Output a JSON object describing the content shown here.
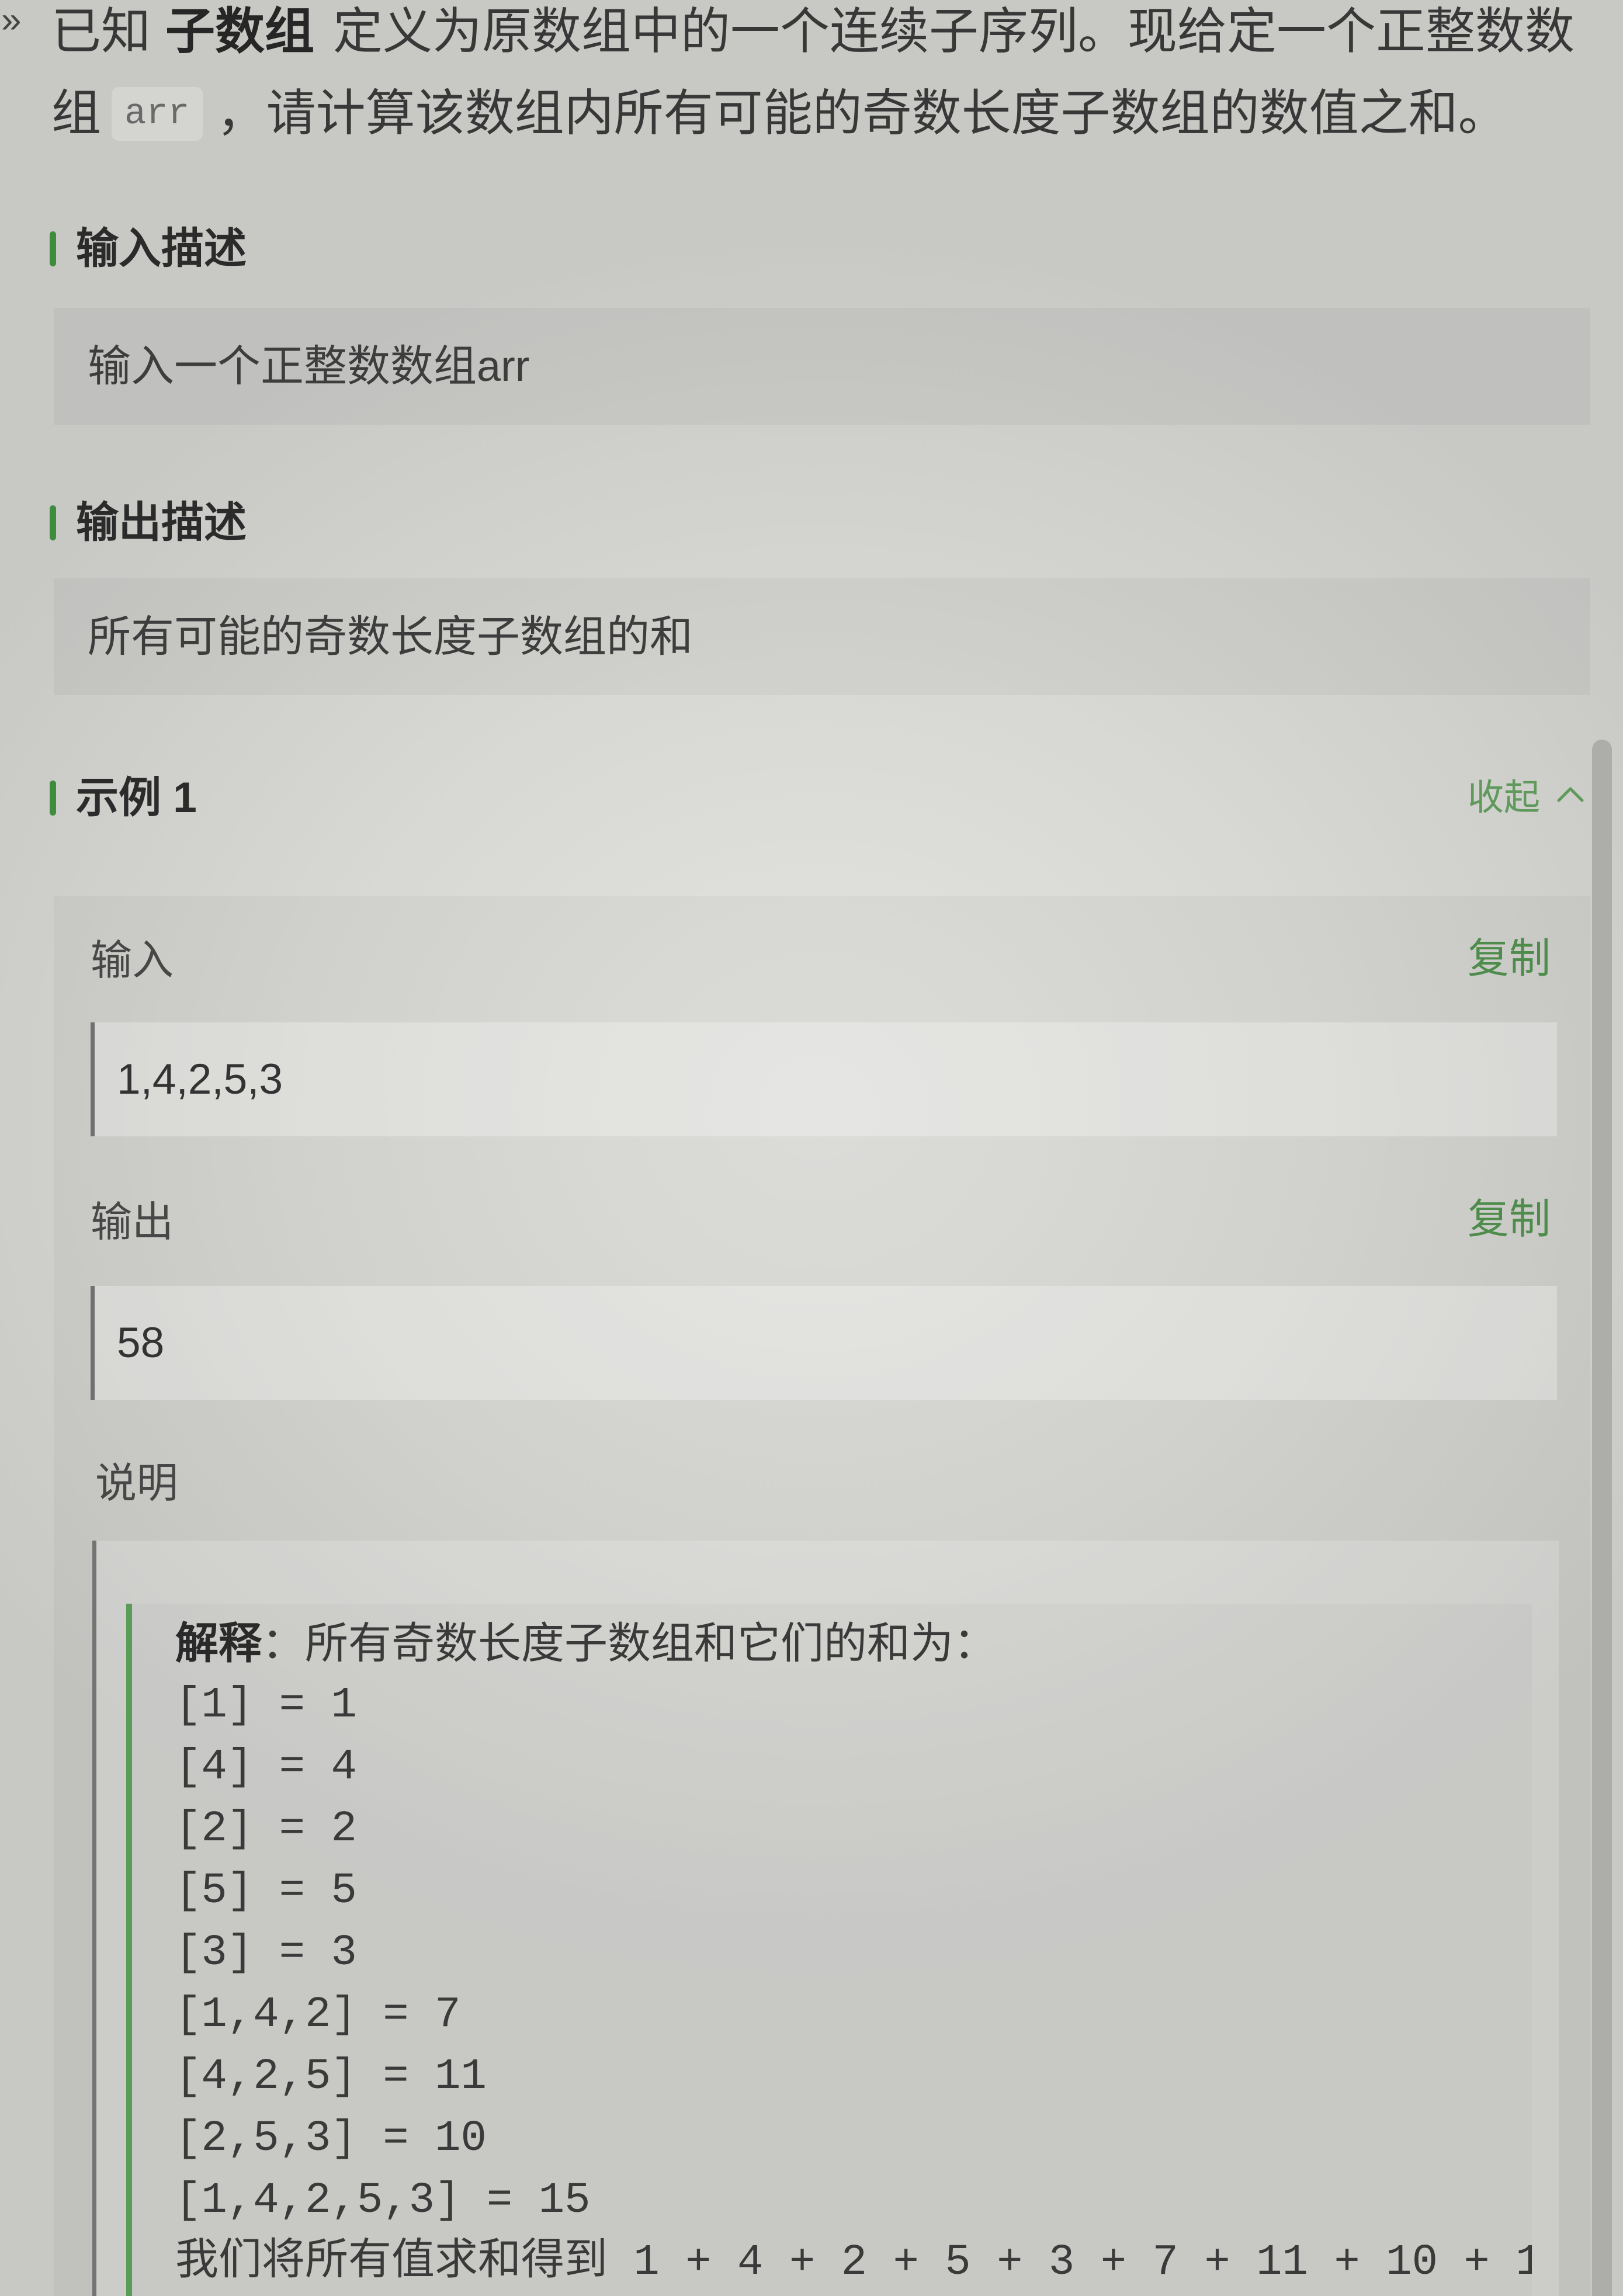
{
  "intro": {
    "marker": "»",
    "prefix": "已知",
    "term": "子数组",
    "line1_rest": "定义为原数组中的一个连续子序列。现给定一个正整数数",
    "line2_start": "组",
    "code": "arr",
    "line2_rest": "，请计算该数组内所有可能的奇数长度子数组的数值之和。"
  },
  "input_description": {
    "heading": "输入描述",
    "text": "输入一个正整数数组arr"
  },
  "output_description": {
    "heading": "输出描述",
    "text": "所有可能的奇数长度子数组的和"
  },
  "example": {
    "heading": "示例 1",
    "collapse_label": "收起",
    "collapse_icon": "chevron-up-icon",
    "input_label": "输入",
    "input_copy": "复制",
    "input_value": "1,4,2,5,3",
    "output_label": "输出",
    "output_copy": "复制",
    "output_value": "58",
    "explanation_label": "说明",
    "explanation": {
      "lead_bold": "解释",
      "lead_rest": "：所有奇数长度子数组和它们的和为：",
      "lines": [
        "[1] = 1",
        "[4] = 4",
        "[2] = 2",
        "[5] = 5",
        "[3] = 3",
        "[1,4,2] = 7",
        "[4,2,5] = 11",
        "[2,5,3] = 10",
        "[1,4,2,5,3] = 15"
      ],
      "summary": "我们将所有值求和得到 1 + 4 + 2 + 5 + 3 + 7 + 11 + 10 + 1"
    }
  },
  "colors": {
    "accent_green": "#3f8c3e",
    "link_green": "#5f9a5c",
    "copy_green": "#4e8c4b",
    "quote_border": "#5b9b58",
    "text": "#383838"
  }
}
